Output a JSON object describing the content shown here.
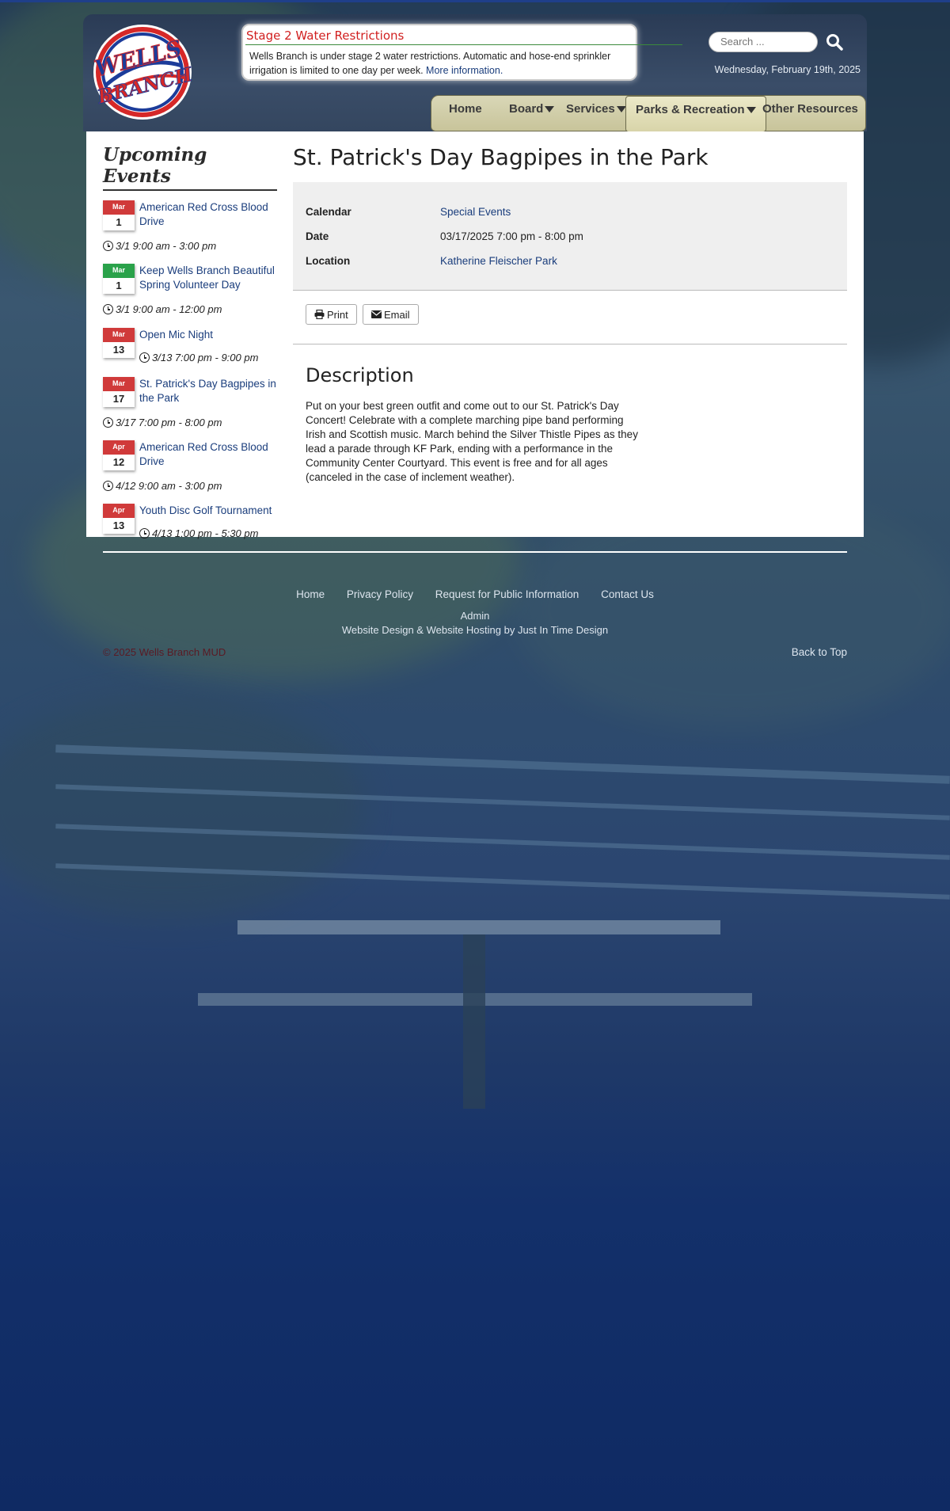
{
  "alert": {
    "title": "Stage 2 Water Restrictions",
    "body": "Wells Branch is under stage 2 water restrictions. Automatic and hose-end sprinkler irrigation is limited to one day per week.",
    "link": "More information."
  },
  "logo": {
    "line1": "WELLS",
    "line2": "BRANCH"
  },
  "search": {
    "placeholder": "Search ..."
  },
  "header": {
    "date": "Wednesday, February 19th, 2025"
  },
  "nav": {
    "home": "Home",
    "board": "Board",
    "services": "Services",
    "parks": "Parks & Recreation",
    "other": "Other Resources"
  },
  "sidebar": {
    "title": "Upcoming Events",
    "events": [
      {
        "month": "Mar",
        "day": "1",
        "title": "American Red Cross Blood Drive",
        "time": "3/1 9:00 am - 3:00 pm",
        "color": "#d03a3a"
      },
      {
        "month": "Mar",
        "day": "1",
        "title": "Keep Wells Branch Beautiful Spring Volunteer Day",
        "time": "3/1 9:00 am - 12:00 pm",
        "color": "#2aa24a"
      },
      {
        "month": "Mar",
        "day": "13",
        "title": "Open Mic Night",
        "time": "3/13 7:00 pm - 9:00 pm",
        "color": "#d03a3a"
      },
      {
        "month": "Mar",
        "day": "17",
        "title": "St. Patrick's Day Bagpipes in the Park",
        "time": "3/17 7:00 pm - 8:00 pm",
        "color": "#d03a3a"
      },
      {
        "month": "Apr",
        "day": "12",
        "title": "American Red Cross Blood Drive",
        "time": "4/12 9:00 am - 3:00 pm",
        "color": "#d03a3a"
      },
      {
        "month": "Apr",
        "day": "13",
        "title": "Youth Disc Golf Tournament",
        "time": "4/13 1:00 pm - 5:30 pm",
        "color": "#d03a3a"
      }
    ]
  },
  "event": {
    "title": "St. Patrick's Day Bagpipes in the Park",
    "calendar_label": "Calendar",
    "calendar_value": "Special Events",
    "date_label": "Date",
    "date_value": "03/17/2025 7:00 pm - 8:00 pm",
    "location_label": "Location",
    "location_value": "Katherine Fleischer Park",
    "print": "Print",
    "email": "Email",
    "description_heading": "Description",
    "description": "Put on your best green outfit and come out to our St. Patrick's Day Concert! Celebrate with a complete marching pipe band performing Irish and Scottish music. March behind the Silver Thistle Pipes as they lead a parade through KF Park, ending with a performance in the Community Center Courtyard. This event is free and for all ages (canceled in the case of inclement weather)."
  },
  "footer": {
    "links": [
      "Home",
      "Privacy Policy",
      "Request for Public Information",
      "Contact Us"
    ],
    "admin": "Admin",
    "credit": "Website Design & Website Hosting by Just In Time Design",
    "copyright": "© 2025 Wells Branch MUD",
    "back_to_top": "Back to Top"
  }
}
